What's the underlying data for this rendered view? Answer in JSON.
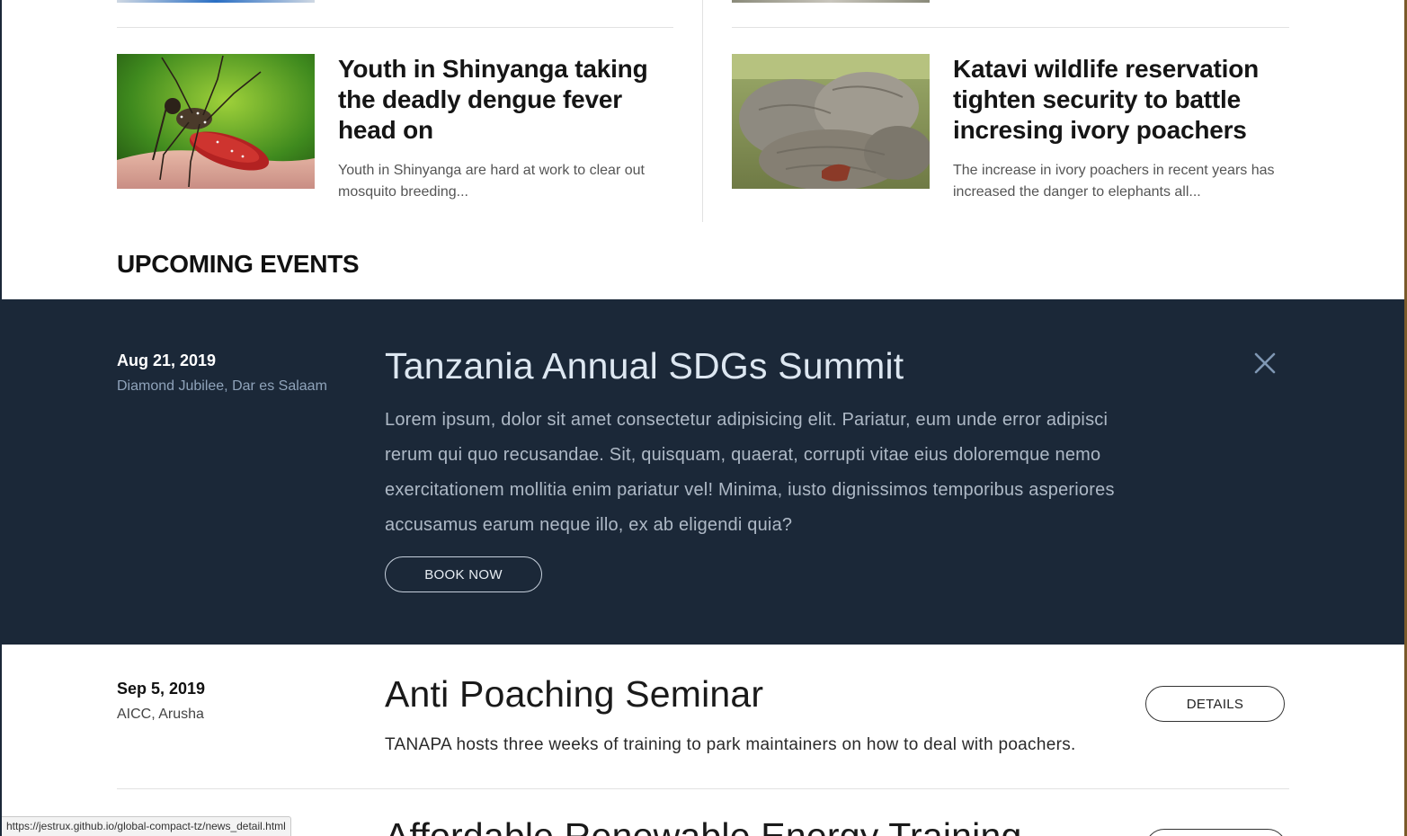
{
  "news": {
    "left": {
      "title": "Youth in Shinyanga taking the deadly dengue fever head on",
      "excerpt": "Youth in Shinyanga are hard at work to clear out mosquito breeding..."
    },
    "right": {
      "title": "Katavi wildlife reservation tighten security to battle incresing ivory poachers",
      "excerpt": "The increase in ivory poachers in recent years has increased the danger to elephants all..."
    }
  },
  "events_section": {
    "heading": "UPCOMING EVENTS"
  },
  "events": [
    {
      "date": "Aug 21, 2019",
      "venue": "Diamond Jubilee, Dar es Salaam",
      "title": "Tanzania Annual SDGs Summit",
      "description": "Lorem ipsum, dolor sit amet consectetur adipisicing elit. Pariatur, eum unde error adipisci rerum qui quo recusandae. Sit, quisquam, quaerat, corrupti vitae eius doloremque nemo exercitationem mollitia enim pariatur vel! Minima, iusto dignissimos temporibus asperiores accusamus earum neque illo, ex ab eligendi quia?",
      "action_label": "BOOK NOW",
      "expanded": true
    },
    {
      "date": "Sep 5, 2019",
      "venue": "AICC, Arusha",
      "title": "Anti Poaching Seminar",
      "description": "TANAPA hosts three weeks of training to park maintainers on how to deal with poachers.",
      "action_label": "DETAILS",
      "expanded": false
    },
    {
      "title": "Affordable Renewable Energy Training"
    }
  ],
  "status_bar": {
    "url": "https://jestrux.github.io/global-compact-tz/news_detail.html"
  },
  "colors": {
    "featured_background": "#1b2838",
    "featured_title": "#dde7f1",
    "featured_venue": "#8fa3ba",
    "close_icon": "#7f97b3"
  }
}
